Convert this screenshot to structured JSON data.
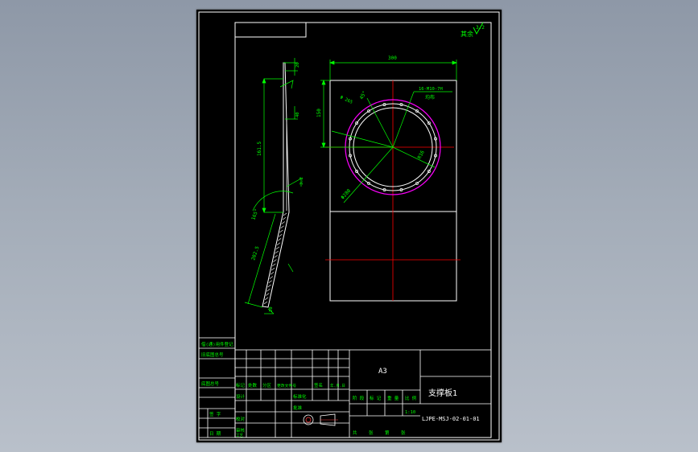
{
  "colors": {
    "frame": "#ffffff",
    "dimension": "#00ff00",
    "outline": "#ffffff",
    "centerline": "#ff0000",
    "pcd_circle": "#ff00ff",
    "hidden": "#ffff00"
  },
  "roughness": {
    "mark": "其余",
    "value": "3.2"
  },
  "front_view": {
    "width_dim": "300",
    "offset_dim": "150",
    "hole_spec_1": "16-M10-7H",
    "hole_spec_2": "均布",
    "angle_dim": "45°",
    "pcd_dim": "Φ 265",
    "dia_dim": "Φ280",
    "radius_dim": "R16"
  },
  "side_view": {
    "top_dim": "20",
    "upper_dim": "40",
    "height_dim": "161.5",
    "bend_angle": "165°",
    "slant_dim": "202.5",
    "bottom_dim": "20",
    "weld": "3.2"
  },
  "title_block": {
    "left_labels": [
      "借(通)用件登记",
      "旧底图总号",
      "底图总号",
      "签 字",
      "日 期"
    ],
    "rev_labels": [
      "标记",
      "处数",
      "分区",
      "更改文件号",
      "签名",
      "年.月.日"
    ],
    "role_labels": [
      "设计",
      "校对",
      "审核",
      "工艺",
      "标准化",
      "批准"
    ],
    "material": "A3",
    "part_name": "支撑板1",
    "stage_labels": [
      "阶 段",
      "标 记",
      "重 量",
      "比 例"
    ],
    "scale": "1:10",
    "sheet_labels": [
      "共",
      "张",
      "第",
      "张"
    ],
    "drawing_no": "LJPE-MSJ-02-01-01"
  }
}
